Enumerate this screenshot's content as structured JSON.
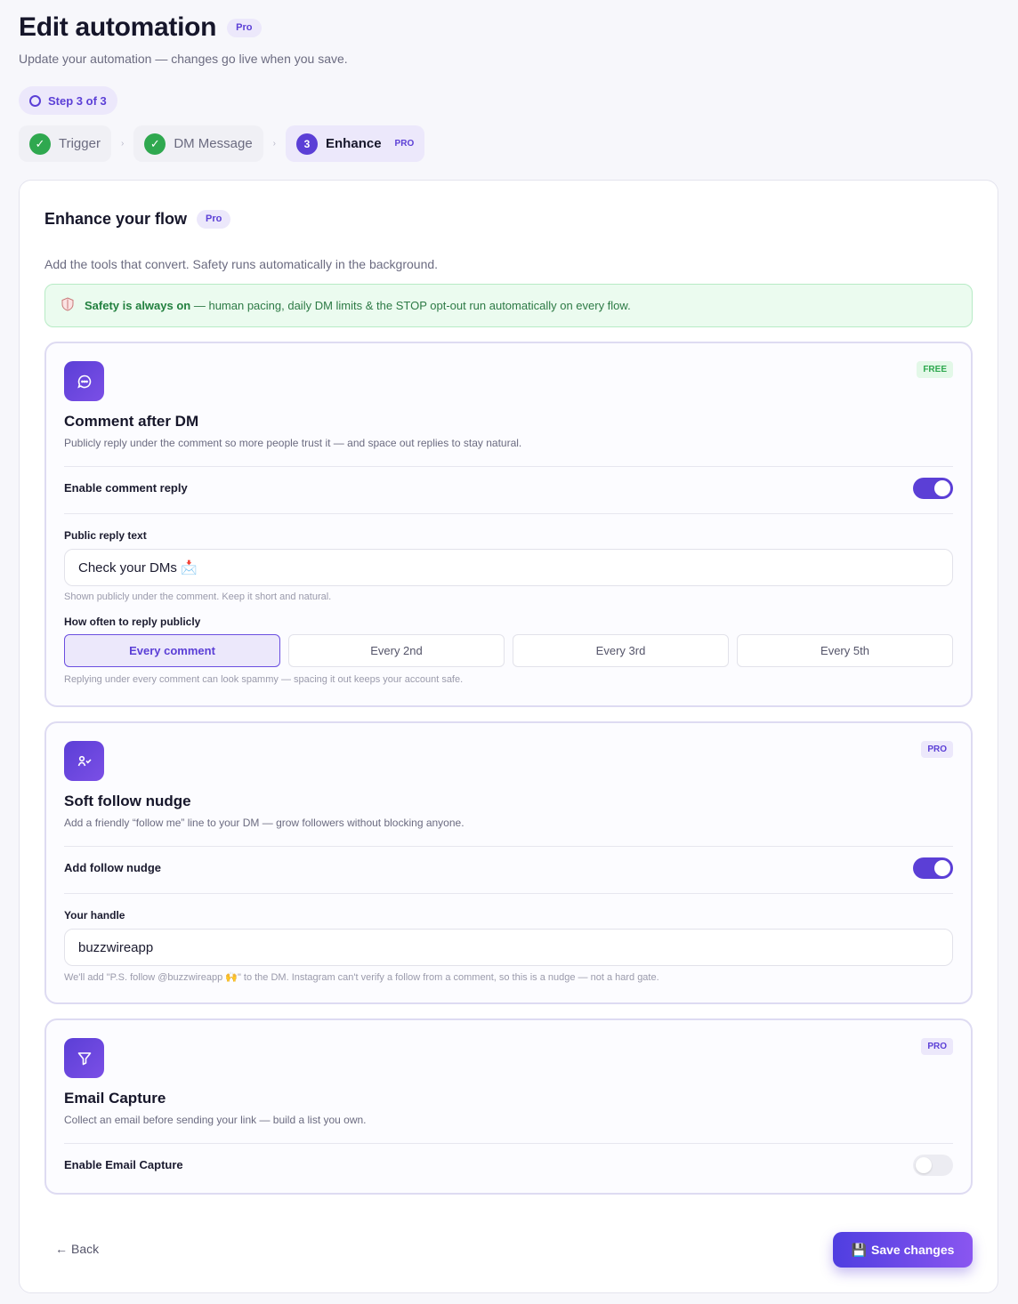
{
  "header": {
    "title": "Edit automation",
    "title_badge": "Pro",
    "subtitle": "Update your automation — changes go live when you save.",
    "step_indicator": "Step 3 of 3"
  },
  "stepper": {
    "steps": [
      {
        "label": "Trigger",
        "state": "done"
      },
      {
        "label": "DM Message",
        "state": "done"
      },
      {
        "label": "Enhance",
        "state": "active",
        "number": "3",
        "tag": "PRO"
      }
    ]
  },
  "panel": {
    "title": "Enhance your flow",
    "title_badge": "Pro",
    "description": "Add the tools that convert. Safety runs automatically in the background.",
    "safety": {
      "bold": "Safety is always on",
      "text": " — human pacing, daily DM limits & the STOP opt-out run automatically on every flow."
    }
  },
  "cards": {
    "comment": {
      "badge": "FREE",
      "title": "Comment after DM",
      "description": "Publicly reply under the comment so more people trust it — and space out replies to stay natural.",
      "toggle_label": "Enable comment reply",
      "toggle_on": true,
      "reply_label": "Public reply text",
      "reply_value": "Check your DMs 📩",
      "reply_hint": "Shown publicly under the comment. Keep it short and natural.",
      "frequency_label": "How often to reply publicly",
      "frequency_options": [
        "Every comment",
        "Every 2nd",
        "Every 3rd",
        "Every 5th"
      ],
      "frequency_selected": "Every comment",
      "frequency_hint": "Replying under every comment can look spammy — spacing it out keeps your account safe."
    },
    "follow": {
      "badge": "PRO",
      "title": "Soft follow nudge",
      "description": "Add a friendly “follow me” line to your DM — grow followers without blocking anyone.",
      "toggle_label": "Add follow nudge",
      "toggle_on": true,
      "handle_label": "Your handle",
      "handle_value": "buzzwireapp",
      "handle_hint": "We'll add \"P.S. follow @buzzwireapp 🙌\" to the DM. Instagram can't verify a follow from a comment, so this is a nudge — not a hard gate."
    },
    "email": {
      "badge": "PRO",
      "title": "Email Capture",
      "description": "Collect an email before sending your link — build a list you own.",
      "toggle_label": "Enable Email Capture",
      "toggle_on": false
    }
  },
  "footer": {
    "back_arrow": "←",
    "back_label": "Back",
    "save_icon": "💾",
    "save_label": "Save changes"
  },
  "colors": {
    "accent": "#5b3fd6",
    "success": "#2fa84f",
    "safety_bg": "#ebfbef"
  },
  "icons": [
    "chat-bubble-icon",
    "user-check-icon",
    "filter-icon",
    "shield-icon",
    "check-icon",
    "save-icon"
  ]
}
